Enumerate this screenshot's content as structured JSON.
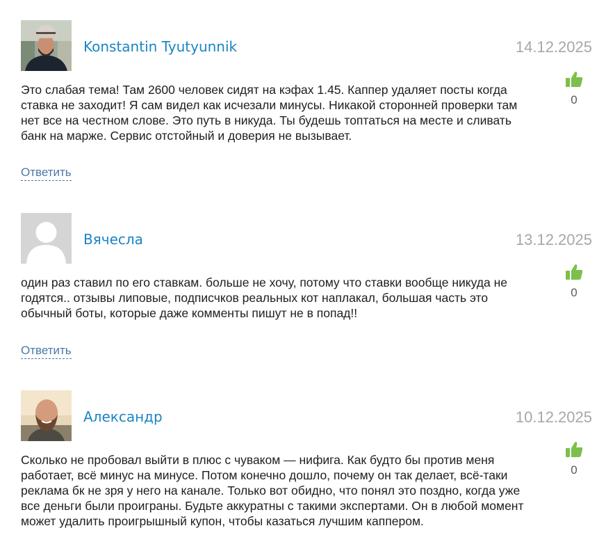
{
  "comments": [
    {
      "author": "Konstantin Tyutyunnik",
      "date": "14.12.2025",
      "text": "Это слабая тема! Там 2600 человек сидят на кэфах 1.45. Каппер удаляет посты когда ставка не заходит! Я сам видел как исчезали минусы. Никакой сторонней проверки там нет все на честном слове. Это путь в никуда. Ты будешь топтаться на месте и сливать банк на марже. Сервис отстойный и доверия не вызывает.",
      "likes": "0",
      "reply_label": "Ответить",
      "avatar": "photo-cowboy-hat"
    },
    {
      "author": "Вячесла",
      "date": "13.12.2025",
      "text": "один раз ставил по его ставкам. больше не хочу, потому что ставки вообще никуда не годятся.. отзывы липовые, подписчков реальных кот наплакал, большая часть это обычный боты, которые даже комменты пишут не в попад!!",
      "likes": "0",
      "reply_label": "Ответить",
      "avatar": "default-placeholder"
    },
    {
      "author": "Александр",
      "date": "10.12.2025",
      "text": "Сколько не пробовал выйти в плюс с чуваком — нифига. Как будто бы против меня работает, всё минус на минусе. Потом конечно дошло, почему он так делает, всё-таки реклама бк не зря у него на канале. Только вот обидно, что понял это поздно, когда уже все деньги были проиграны. Будьте аккуратны с такими экспертами. Он в любой момент может удалить проигрышный купон, чтобы казаться лучшим каппером.",
      "likes": "0",
      "reply_label": "",
      "avatar": "photo-bald-bearded"
    }
  ],
  "colors": {
    "author": "#1b84c4",
    "date": "#a3a8ae",
    "text": "#1e1e1e",
    "like": "#7cc04b",
    "reply": "#4a78a8"
  },
  "icons": {
    "like": "thumbs-up-icon"
  }
}
